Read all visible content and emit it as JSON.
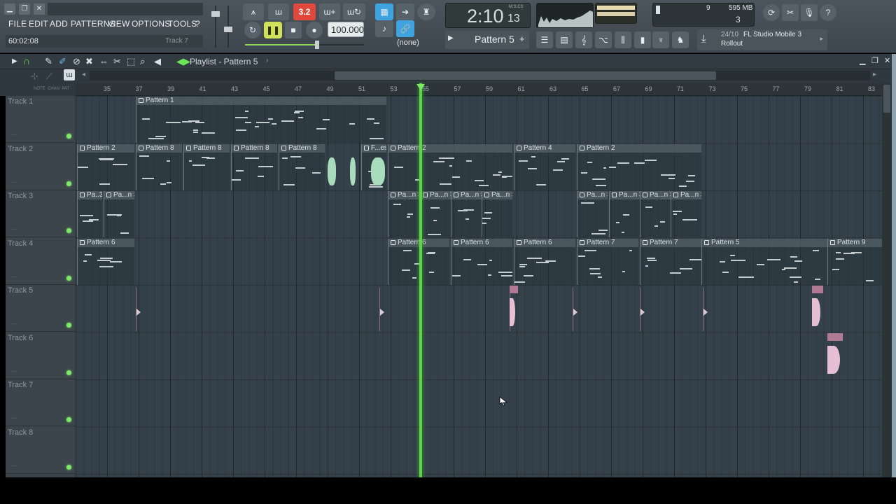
{
  "menu": {
    "items": [
      "FILE",
      "EDIT",
      "ADD",
      "PATTERNS",
      "VIEW",
      "OPTIONS",
      "TOOLS",
      "?"
    ]
  },
  "status": {
    "time": "60:02:08",
    "hint": "Track 7"
  },
  "transport": {
    "tempo": "100.000",
    "time_main": "2:10",
    "time_sub": "13",
    "time_unit": "M:S:CS",
    "mode_label": "(none)"
  },
  "meters": {
    "voices": "9",
    "memory": "595 MB",
    "cpu": "3"
  },
  "pattern_selector": {
    "label": "Pattern 5"
  },
  "news": {
    "date": "24/10",
    "title": "FL Studio Mobile 3",
    "subtitle": "Rollout"
  },
  "playlist": {
    "title": "Playlist - Pattern 5",
    "ruler": [
      "35",
      "37",
      "39",
      "41",
      "43",
      "45",
      "47",
      "49",
      "51",
      "53",
      "55",
      "57",
      "59",
      "61",
      "63",
      "65",
      "67",
      "69",
      "71",
      "73",
      "75",
      "77",
      "79",
      "81",
      "83"
    ],
    "tracks": [
      "Track 1",
      "Track 2",
      "Track 3",
      "Track 4",
      "Track 5",
      "Track 6",
      "Track 7",
      "Track 8"
    ],
    "clips": {
      "t1": [
        "Pattern 1"
      ],
      "t2": [
        "Pattern 2",
        "Pattern 8",
        "Pattern 8",
        "Pattern 8",
        "Pattern 8",
        "F...es",
        "Pattern 2",
        "Pattern 4",
        "Pattern 2"
      ],
      "t3": [
        "Pa..3",
        "Pa...n 3",
        "Pa...n 3",
        "Pa...n 3",
        "Pa...n 3",
        "Pa...n 3",
        "Pa...n 3",
        "Pa...n 3",
        "Pa...n 3",
        "Pa...n 3"
      ],
      "t4": [
        "Pattern 6",
        "Pattern 6",
        "Pattern 6",
        "Pattern 6",
        "Pattern 7",
        "Pattern 7",
        "Pattern 5",
        "Pattern 9"
      ]
    }
  },
  "colors": {
    "playhead": "#5ed64a",
    "accent_red": "#e0483e",
    "accent_blue": "#3fa3e0",
    "led_green": "#7fe86a"
  }
}
